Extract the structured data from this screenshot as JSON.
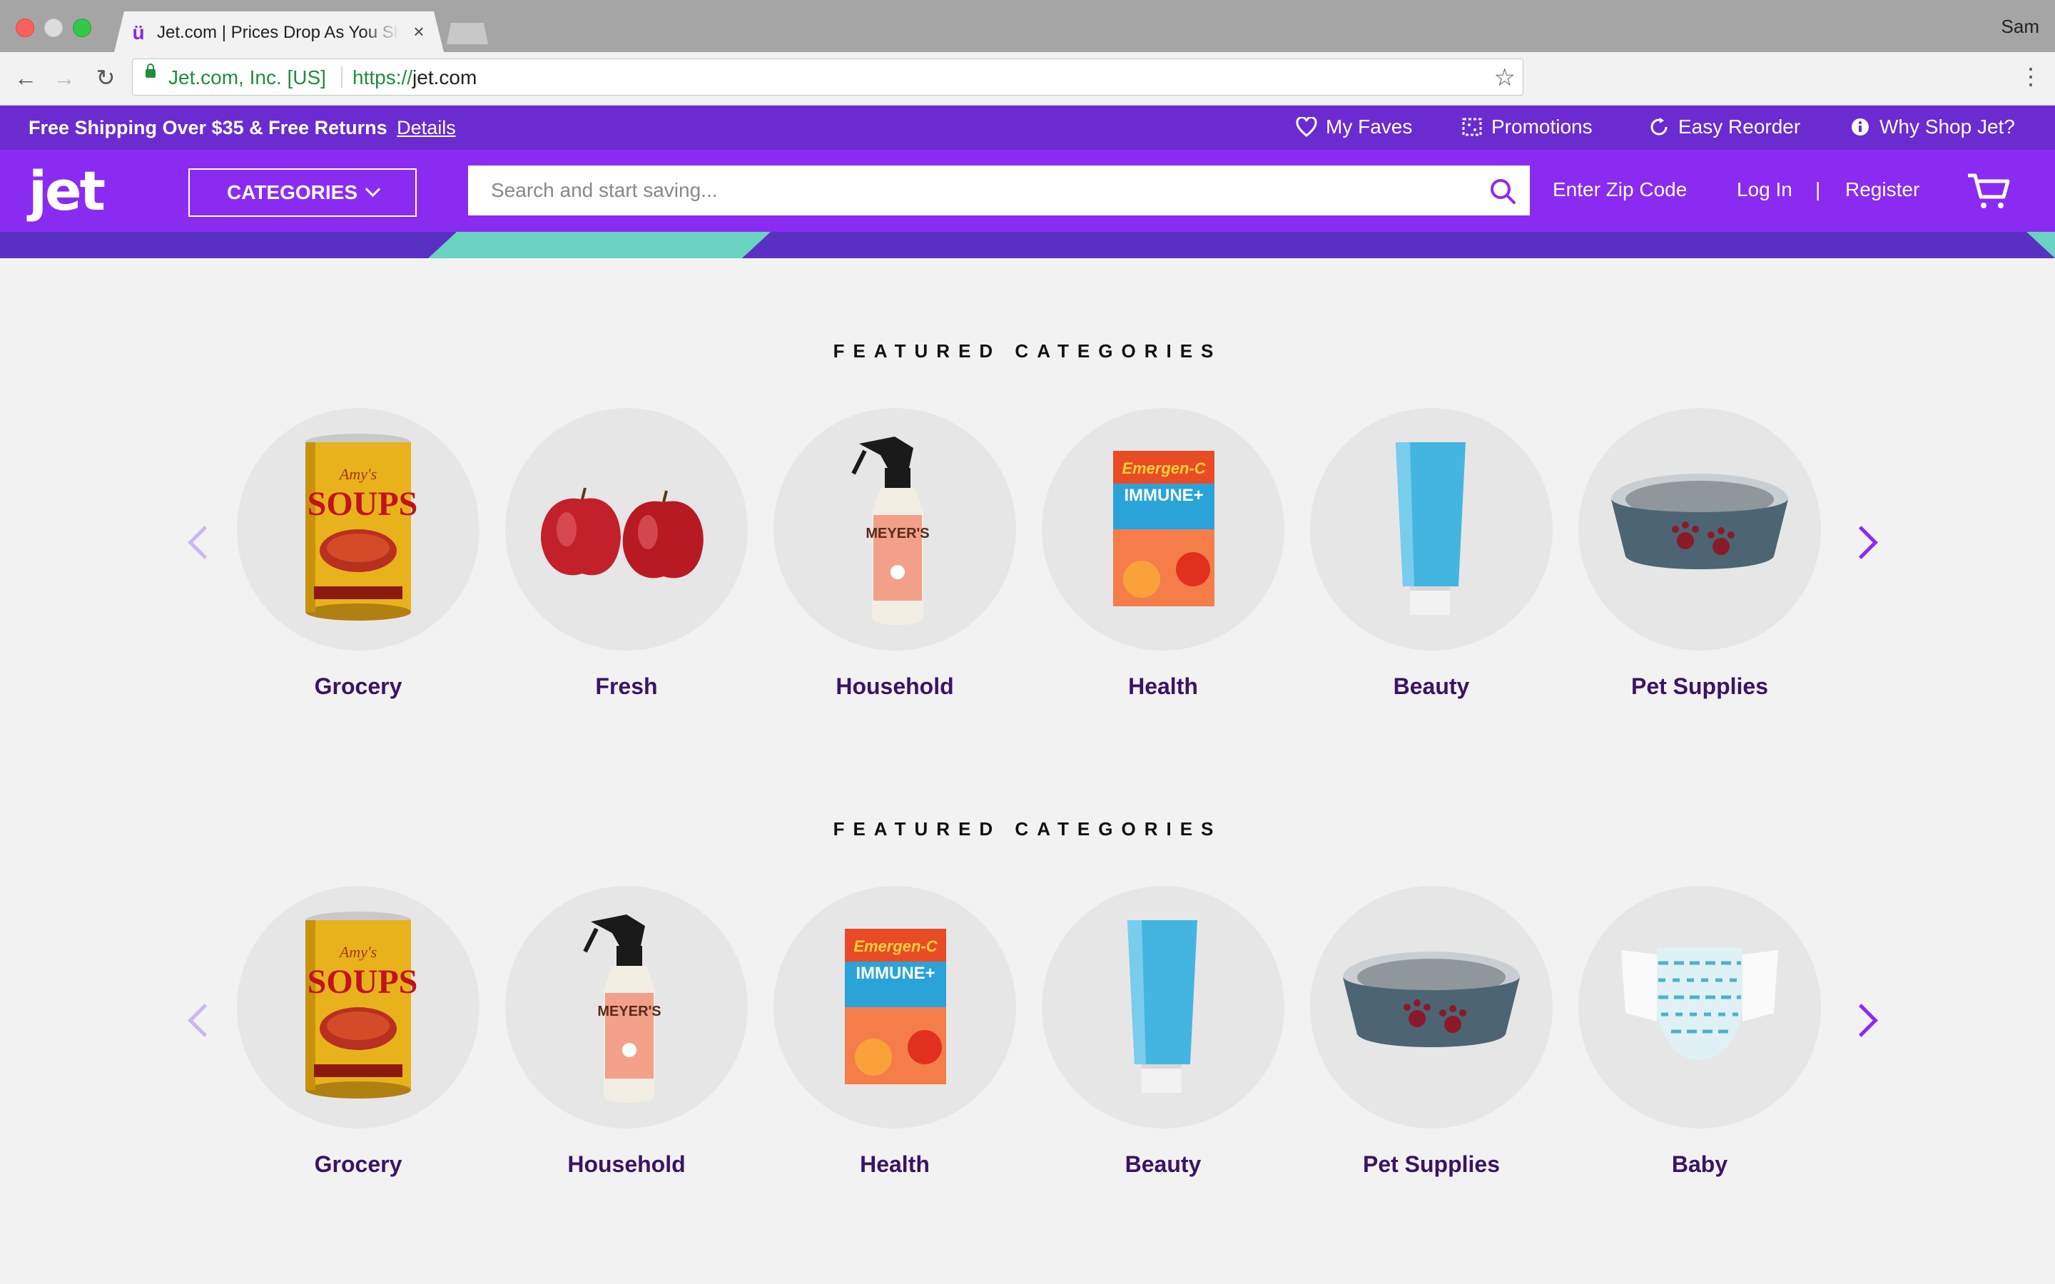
{
  "browser": {
    "tab_title": "Jet.com | Prices Drop As You Shop",
    "tab_favicon": "ü",
    "close_glyph": "×",
    "profile_name": "Sam",
    "site_identity": "Jet.com, Inc. [US]",
    "url_scheme": "https://",
    "url_host": "jet.com"
  },
  "promo": {
    "text": "Free Shipping Over $35 & Free Returns",
    "link": "Details",
    "utilities": [
      {
        "label": "My Faves",
        "icon": "heart-icon"
      },
      {
        "label": "Promotions",
        "icon": "promotions-icon"
      },
      {
        "label": "Easy Reorder",
        "icon": "reorder-icon"
      },
      {
        "label": "Why Shop Jet?",
        "icon": "info-icon"
      }
    ]
  },
  "nav": {
    "logo": "jet",
    "categories_button": "CATEGORIES",
    "search_placeholder": "Search and start saving...",
    "zip": "Enter Zip Code",
    "login": "Log In",
    "separator": "|",
    "register": "Register"
  },
  "sections": [
    {
      "title": "FEATURED CATEGORIES",
      "items": [
        {
          "label": "Grocery",
          "icon": "soup-can-icon"
        },
        {
          "label": "Fresh",
          "icon": "apples-icon"
        },
        {
          "label": "Household",
          "icon": "spray-bottle-icon"
        },
        {
          "label": "Health",
          "icon": "vitamin-box-icon"
        },
        {
          "label": "Beauty",
          "icon": "tube-icon"
        },
        {
          "label": "Pet Supplies",
          "icon": "pet-bowl-icon"
        }
      ]
    },
    {
      "title": "FEATURED CATEGORIES",
      "items": [
        {
          "label": "Grocery",
          "icon": "soup-can-icon"
        },
        {
          "label": "Household",
          "icon": "spray-bottle-icon"
        },
        {
          "label": "Health",
          "icon": "vitamin-box-icon"
        },
        {
          "label": "Beauty",
          "icon": "tube-icon"
        },
        {
          "label": "Pet Supplies",
          "icon": "pet-bowl-icon"
        },
        {
          "label": "Baby",
          "icon": "diaper-icon"
        }
      ]
    }
  ],
  "colors": {
    "promo_bar": "#6c2ad1",
    "nav_bar": "#8a2bf2",
    "label_text": "#3a1466",
    "circle_bg": "#e6e6e6"
  }
}
